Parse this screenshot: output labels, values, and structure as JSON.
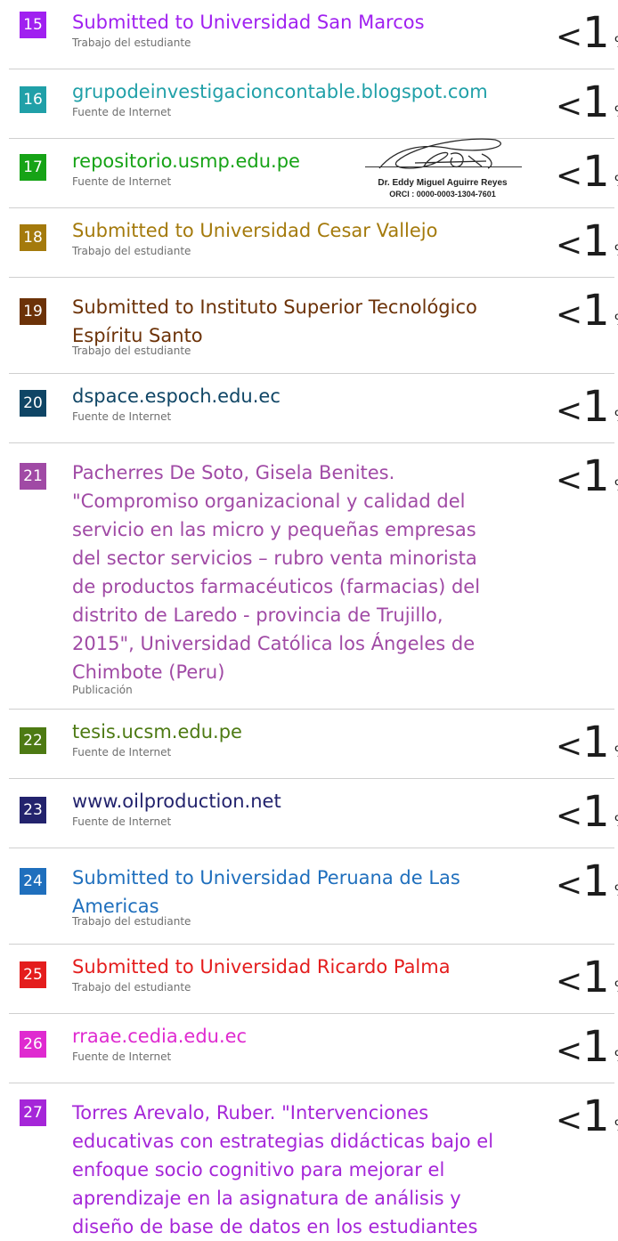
{
  "percent_symbol": "%",
  "lt_symbol": "<",
  "rows": [
    {
      "num": "15",
      "color": "#a020f0",
      "title": "Submitted to Universidad San Marcos",
      "type": "Trabajo del estudiante",
      "value": "1"
    },
    {
      "num": "16",
      "color": "#20a0a8",
      "title": "grupodeinvestigacioncontable.blogspot.com",
      "type": "Fuente de Internet",
      "value": "1"
    },
    {
      "num": "17",
      "color": "#16a316",
      "title": "repositorio.usmp.edu.pe",
      "type": "Fuente de Internet",
      "value": "1"
    },
    {
      "num": "18",
      "color": "#a47a0c",
      "title": "Submitted to Universidad Cesar Vallejo",
      "type": "Trabajo del estudiante",
      "value": "1"
    },
    {
      "num": "19",
      "color": "#6c3208",
      "title": "Submitted to Instituto Superior Tecnológico\nEspíritu Santo",
      "type": "Trabajo del estudiante",
      "value": "1"
    },
    {
      "num": "20",
      "color": "#0f4565",
      "title": "dspace.espoch.edu.ec",
      "type": "Fuente de Internet",
      "value": "1"
    },
    {
      "num": "21",
      "color": "#a04aa5",
      "title": "Pacherres De Soto, Gisela Benites.\n\"Compromiso organizacional y calidad del\nservicio en las micro y pequeñas empresas\ndel sector servicios – rubro venta minorista\nde productos farmacéuticos (farmacias) del\ndistrito de Laredo - provincia de Trujillo,\n2015\", Universidad Católica los Ángeles de\nChimbote (Peru)",
      "type": "Publicación",
      "value": "1"
    },
    {
      "num": "22",
      "color": "#4d7a13",
      "title": "tesis.ucsm.edu.pe",
      "type": "Fuente de Internet",
      "value": "1"
    },
    {
      "num": "23",
      "color": "#23236d",
      "title": "www.oilproduction.net",
      "type": "Fuente de Internet",
      "value": "1"
    },
    {
      "num": "24",
      "color": "#1f6fbd",
      "title": "Submitted to Universidad Peruana de Las\nAmericas",
      "type": "Trabajo del estudiante",
      "value": "1"
    },
    {
      "num": "25",
      "color": "#e41d1d",
      "title": "Submitted to Universidad Ricardo Palma",
      "type": "Trabajo del estudiante",
      "value": "1"
    },
    {
      "num": "26",
      "color": "#df2ad0",
      "title": "rraae.cedia.edu.ec",
      "type": "Fuente de Internet",
      "value": "1"
    },
    {
      "num": "27",
      "color": "#a526d8",
      "title": "Torres Arevalo, Ruber. \"Intervenciones\neducativas con estrategias didácticas bajo el\nenfoque socio cognitivo para mejorar el\naprendizaje en la asignatura de análisis y\ndiseño de base de datos en los estudiantes",
      "type": "",
      "value": "1"
    }
  ],
  "stamp": {
    "name": "Dr. Eddy Miguel Aguirre Reyes",
    "orci": "ORCI : 0000-0003-1304-7601"
  }
}
